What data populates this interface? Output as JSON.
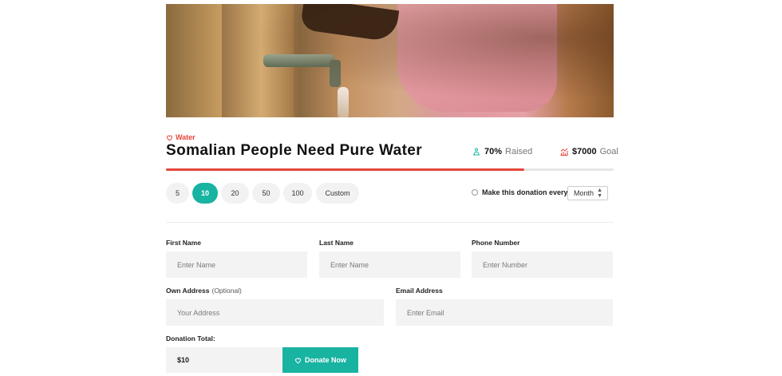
{
  "cause": {
    "category": "Water",
    "title": "Somalian People Need Pure Water",
    "raised": {
      "value": "70%",
      "label": "Raised"
    },
    "goal": {
      "value": "$7000",
      "label": "Goal"
    },
    "progress_fraction": 0.8
  },
  "amounts": [
    {
      "label": "5",
      "active": false
    },
    {
      "label": "10",
      "active": true
    },
    {
      "label": "20",
      "active": false
    },
    {
      "label": "50",
      "active": false
    },
    {
      "label": "100",
      "active": false
    },
    {
      "label": "Custom",
      "active": false
    }
  ],
  "recurring": {
    "label": "Make this donation every",
    "frequency": "Month"
  },
  "form": {
    "first_name": {
      "label": "First Name",
      "placeholder": "Enter Name"
    },
    "last_name": {
      "label": "Last Name",
      "placeholder": "Enter Name"
    },
    "phone": {
      "label": "Phone Number",
      "placeholder": "Enter Number"
    },
    "address": {
      "label": "Own Address",
      "optional": "(Optional)",
      "placeholder": "Your Address"
    },
    "email": {
      "label": "Email Address",
      "placeholder": "Enter Email"
    },
    "total": {
      "label": "Donation Total:",
      "value": "$10"
    },
    "donate_label": "Donate Now"
  },
  "colors": {
    "accent": "#19b3a2",
    "red": "#e4453a"
  },
  "icons": {
    "category": "heart-icon",
    "raised": "raised-icon",
    "goal": "goal-chart-icon",
    "donate": "heart-icon"
  }
}
